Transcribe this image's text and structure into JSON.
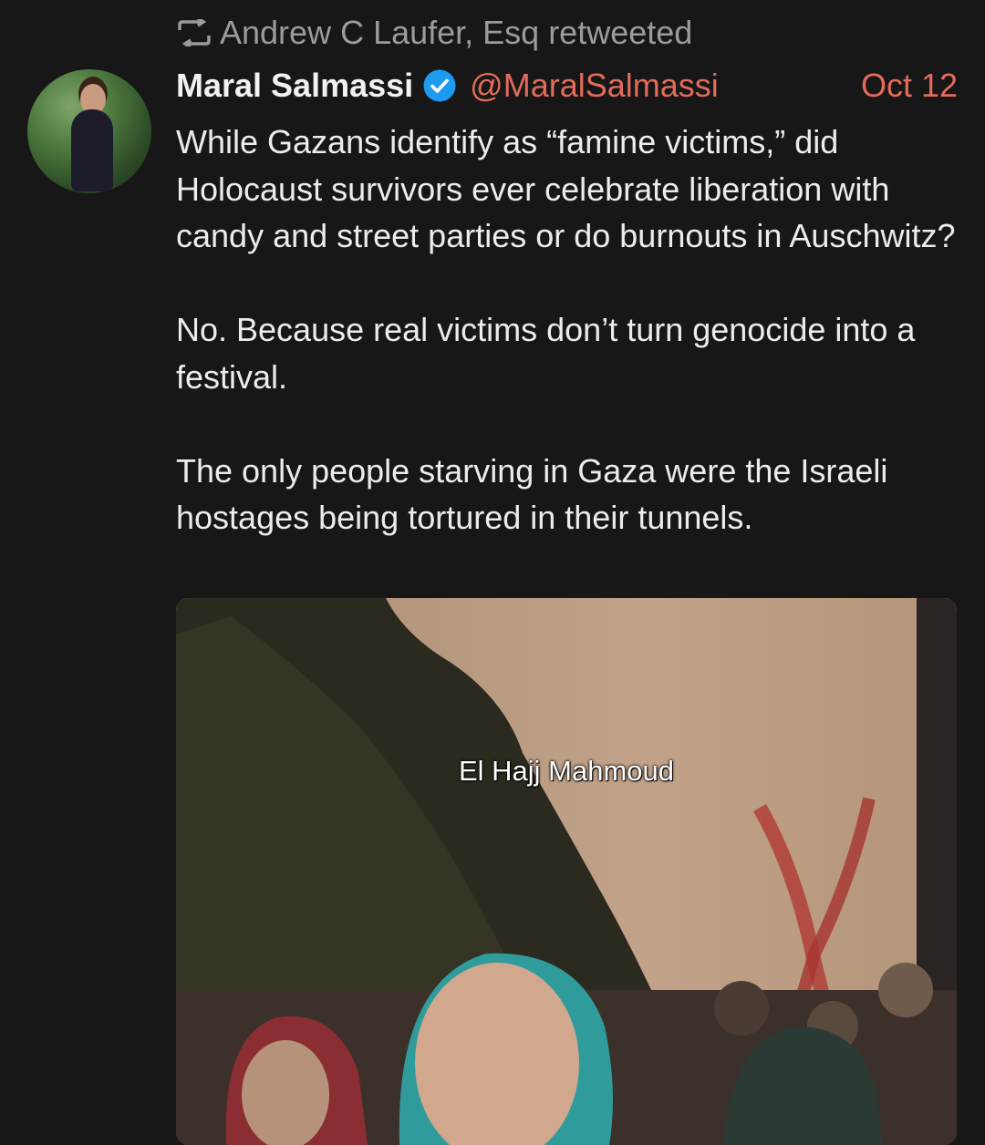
{
  "retweet": {
    "icon": "retweet-icon",
    "text": "Andrew C Laufer, Esq retweeted"
  },
  "tweet": {
    "author": {
      "name": "Maral Salmassi",
      "verified_icon": "verified-badge-icon",
      "handle": "@MaralSalmassi",
      "avatar": "profile-avatar"
    },
    "date": "Oct 12",
    "paragraphs": [
      "While Gazans identify as “famine victims,” did Holocaust survivors ever celebrate liberation with candy and street parties or do burnouts in Auschwitz?",
      "No. Because real victims don’t turn genocide into a festival.",
      "The only people starving in Gaza were the Israeli hostages being tortured in their tunnels."
    ],
    "media": {
      "caption": "El Hajj Mahmoud"
    }
  },
  "colors": {
    "background": "#171717",
    "text": "#ececec",
    "muted": "#9b9b9b",
    "accent": "#e36b5a",
    "verified": "#1d9bf0"
  }
}
